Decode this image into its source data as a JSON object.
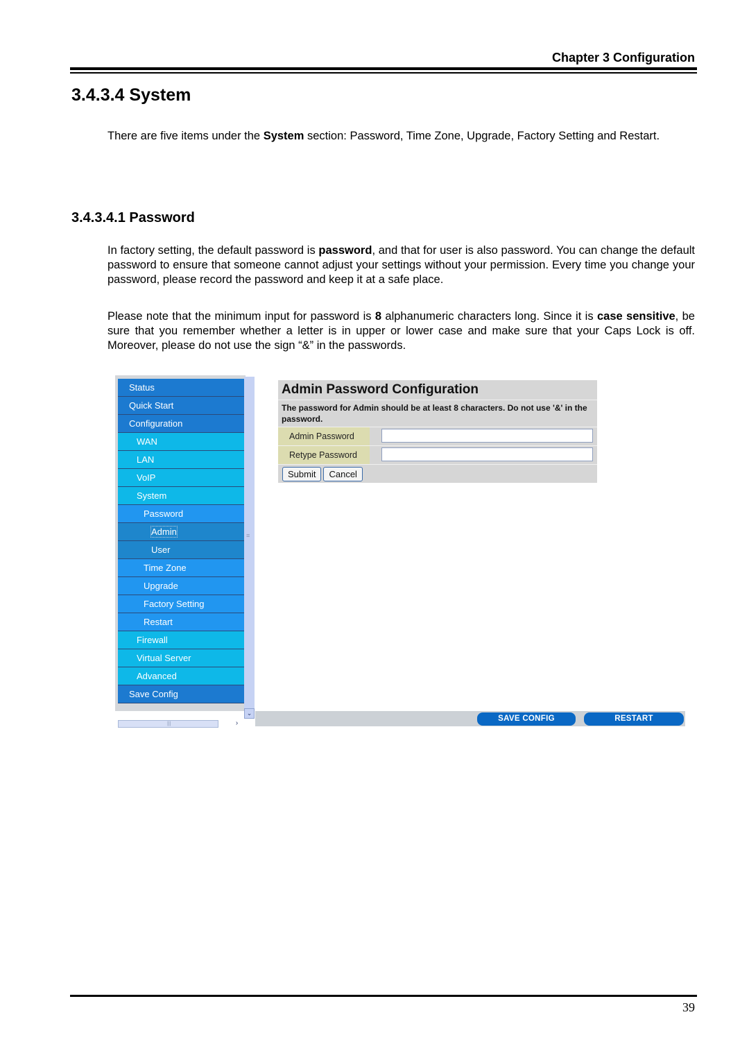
{
  "header": {
    "chapter": "Chapter 3 Configuration"
  },
  "section": {
    "title": "3.4.3.4 System",
    "intro": {
      "pre": "There are five items under the ",
      "bold": "System",
      "post": " section: Password, Time Zone, Upgrade, Factory Setting and Restart."
    }
  },
  "subsection": {
    "title": "3.4.3.4.1 Password",
    "para1": {
      "pre": "In factory setting, the default password is ",
      "bold": "password",
      "post": ", and that for user is also password. You can change the default password to ensure that someone cannot adjust your settings without your permission. Every time you change your password, please record the password and keep it at a safe place."
    },
    "para2": {
      "pre": "Please note that the minimum input for password is ",
      "bold1": "8",
      "mid": " alphanumeric characters long. Since it is ",
      "bold2": "case sensitive",
      "post": ", be sure that you remember whether a letter is in upper or lower case and make sure that your Caps Lock is off. Moreover, please do not use the sign “&” in the passwords."
    }
  },
  "screenshot": {
    "nav": [
      {
        "label": "Status",
        "level": 0
      },
      {
        "label": "Quick Start",
        "level": 0
      },
      {
        "label": "Configuration",
        "level": 0
      },
      {
        "label": "WAN",
        "level": 1
      },
      {
        "label": "LAN",
        "level": 1
      },
      {
        "label": "VoIP",
        "level": 1
      },
      {
        "label": "System",
        "level": 1
      },
      {
        "label": "Password",
        "level": 2
      },
      {
        "label": "Admin",
        "level": 3,
        "active": true
      },
      {
        "label": "User",
        "level": 3
      },
      {
        "label": "Time Zone",
        "level": 2
      },
      {
        "label": "Upgrade",
        "level": 2
      },
      {
        "label": "Factory Setting",
        "level": 2
      },
      {
        "label": "Restart",
        "level": 2
      },
      {
        "label": "Firewall",
        "level": 1
      },
      {
        "label": "Virtual Server",
        "level": 1
      },
      {
        "label": "Advanced",
        "level": 1
      },
      {
        "label": "Save Config",
        "level": 0
      }
    ],
    "panel": {
      "title": "Admin Password Configuration",
      "description": "The password for Admin should be at least 8 characters. Do not use '&' in the password.",
      "fields": [
        {
          "label": "Admin Password",
          "value": ""
        },
        {
          "label": "Retype Password",
          "value": ""
        }
      ],
      "submit_label": "Submit",
      "cancel_label": "Cancel"
    },
    "bottom_bar": {
      "save_config_label": "SAVE CONFIG",
      "restart_label": "RESTART"
    },
    "colors": {
      "nav_top": "#1c7ad0",
      "nav_section": "#0eb8e8",
      "nav_sub": "#2196f0",
      "nav_leaf": "#1e86cc",
      "action_button": "#0a68c4",
      "field_label_bg": "#dcdcb0"
    }
  },
  "footer": {
    "page_number": "39"
  }
}
